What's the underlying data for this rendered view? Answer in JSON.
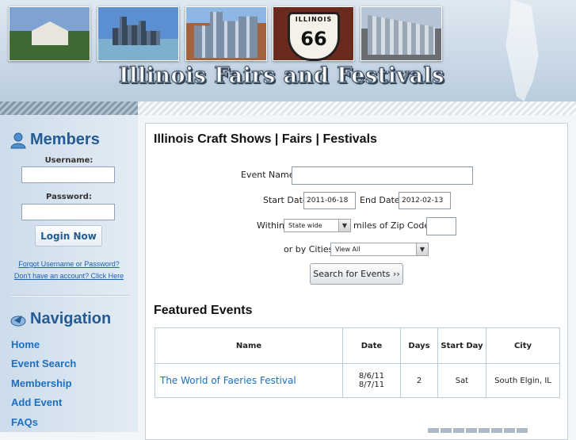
{
  "header": {
    "site_title": "Illinois Fairs and Festivals",
    "photos": [
      "house-photo",
      "chicago-skyline-photo",
      "city-buildings-photo",
      "route-66-sign-photo",
      "train-station-photo"
    ],
    "route66": {
      "top_text": "ILLINOIS",
      "number": "66"
    }
  },
  "sidebar": {
    "members_title": "Members",
    "username_label": "Username:",
    "password_label": "Password:",
    "login_label": "Login Now",
    "forgot_link": "Forgot Username or Password?",
    "register_link": "Don't have an account? Click Here",
    "navigation_title": "Navigation",
    "nav_items": [
      {
        "label": "Home"
      },
      {
        "label": "Event Search"
      },
      {
        "label": "Membership"
      },
      {
        "label": "Add Event"
      },
      {
        "label": "FAQs"
      }
    ]
  },
  "main": {
    "title": "Illinois Craft Shows | Fairs | Festivals",
    "form": {
      "event_name_label": "Event Name",
      "event_name_value": "",
      "start_date_label": "Start Date",
      "start_date_value": "2011-06-18",
      "end_date_label": "End Date",
      "end_date_value": "2012-02-13",
      "within_label": "Within",
      "within_value": "State wide",
      "zip_label": "miles of Zip Code:",
      "zip_value": "",
      "cities_label": "or by Cities",
      "cities_value": "View All",
      "search_label": "Search for Events ››"
    },
    "featured_title": "Featured Events",
    "table": {
      "headers": [
        "Name",
        "Date",
        "Days",
        "Start Day",
        "City"
      ],
      "rows": [
        {
          "name": "The World of Faeries Festival",
          "date1": "8/6/11",
          "date2": "8/7/11",
          "days": "2",
          "start_day": "Sat",
          "city": "South Elgin, IL"
        }
      ]
    }
  },
  "colors": {
    "accent": "#1d6fc0",
    "heading": "#245b93"
  }
}
